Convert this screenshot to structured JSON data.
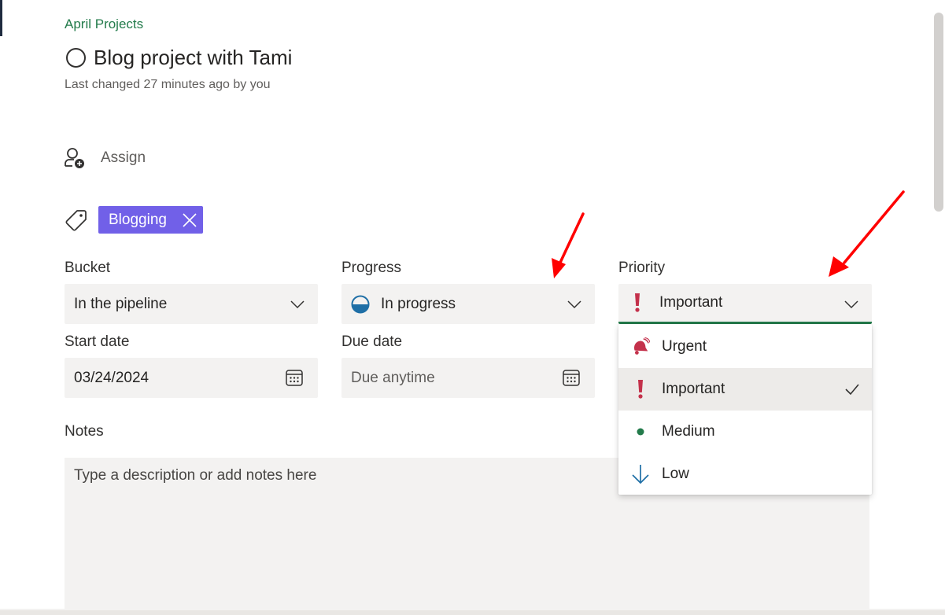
{
  "header": {
    "project_name": "April Projects",
    "task_title": "Blog project with Tami",
    "last_changed": "Last changed 27 minutes ago by you"
  },
  "assign": {
    "label": "Assign"
  },
  "labels": {
    "items": [
      {
        "name": "Blogging",
        "color": "#7160e8"
      }
    ]
  },
  "fields": {
    "bucket": {
      "label": "Bucket",
      "value": "In the pipeline"
    },
    "progress": {
      "label": "Progress",
      "value": "In progress"
    },
    "priority": {
      "label": "Priority",
      "value": "Important"
    },
    "start_date": {
      "label": "Start date",
      "value": "03/24/2024"
    },
    "due_date": {
      "label": "Due date",
      "placeholder": "Due anytime"
    }
  },
  "priority_options": [
    {
      "label": "Urgent",
      "icon": "bell-urgent-icon",
      "selected": false
    },
    {
      "label": "Important",
      "icon": "exclamation-icon",
      "selected": true
    },
    {
      "label": "Medium",
      "icon": "dot-icon",
      "selected": false
    },
    {
      "label": "Low",
      "icon": "arrow-down-icon",
      "selected": false
    }
  ],
  "notes": {
    "label": "Notes",
    "placeholder": "Type a description or add notes here"
  },
  "colors": {
    "accent_green": "#237b4b",
    "label_purple": "#7160e8",
    "priority_red": "#c4314b",
    "progress_blue": "#1f6fa6",
    "annotation_red": "#ff0000"
  }
}
